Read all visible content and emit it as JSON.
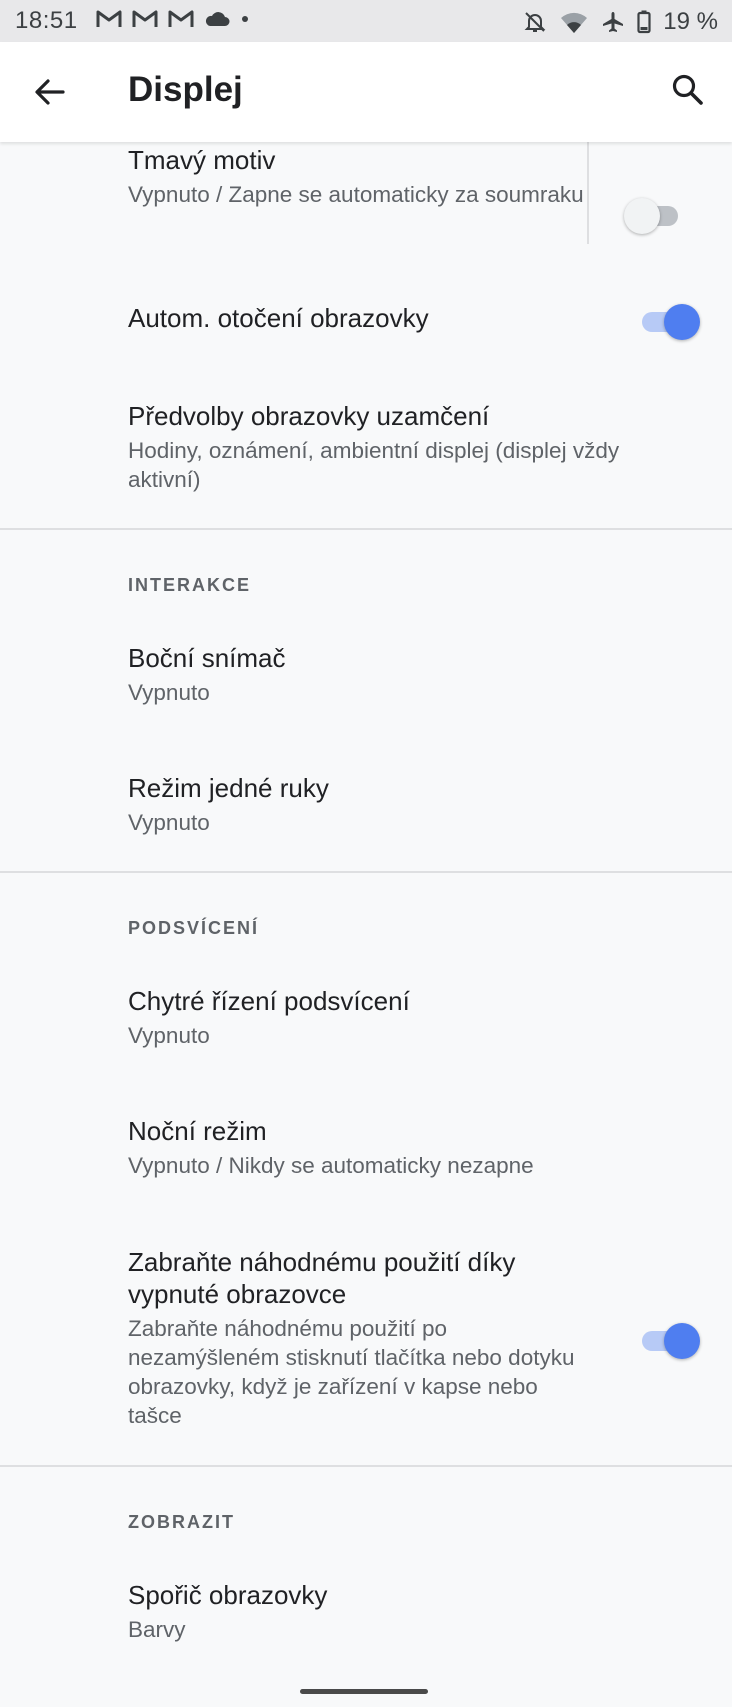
{
  "status_bar": {
    "time": "18:51",
    "battery": "19 %",
    "left_icons": [
      "gmail-icon",
      "gmail-icon",
      "gmail-icon",
      "cloud-icon",
      "dot-icon"
    ],
    "right_icons": [
      "notifications-off-icon",
      "wifi-icon",
      "airplane-icon",
      "battery-icon"
    ]
  },
  "app_bar": {
    "title": "Displej",
    "back_icon": "arrow-back-icon",
    "search_icon": "search-icon"
  },
  "settings": {
    "dark_theme": {
      "title": "Tmavý motiv",
      "summary": "Vypnuto / Zapne se automaticky za soumraku",
      "switch_on": false
    },
    "auto_rotate": {
      "title": "Autom. otočení obrazovky",
      "switch_on": true
    },
    "lock_screen": {
      "title": "Předvolby obrazovky uzamčení",
      "summary": "Hodiny, oznámení, ambientní displej (displej vždy aktivní)"
    },
    "interaction_header": "INTERAKCE",
    "side_sensor": {
      "title": "Boční snímač",
      "summary": "Vypnuto"
    },
    "one_hand": {
      "title": "Režim jedné ruky",
      "summary": "Vypnuto"
    },
    "backlight_header": "PODSVÍCENÍ",
    "smart_backlight": {
      "title": "Chytré řízení podsvícení",
      "summary": "Vypnuto"
    },
    "night_mode": {
      "title": "Noční režim",
      "summary": "Vypnuto / Nikdy se automaticky nezapne"
    },
    "pocket_mode": {
      "title": "Zabraňte náhodnému použití díky vypnuté obrazovce",
      "summary": "Zabraňte náhodnému použití po nezamýšleném stisknutí tlačítka nebo dotyku obrazovky, když je zařízení v kapse nebo tašce",
      "switch_on": true
    },
    "display_header": "ZOBRAZIT",
    "screensaver": {
      "title": "Spořič obrazovky",
      "summary": "Barvy"
    }
  },
  "colors": {
    "accent": "#4f7ef0",
    "background": "#f8f9fa",
    "app_bar": "#ffffff",
    "status_bar": "#e8e8ea"
  }
}
